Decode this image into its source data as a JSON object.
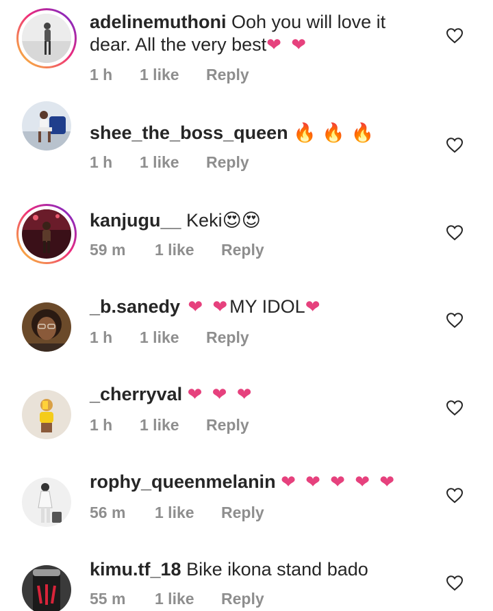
{
  "comments": [
    {
      "username": "adelinemuthoni",
      "text_line1": " Ooh you will love it",
      "text_line2": "dear. All the very best",
      "emoji": "❤ ❤",
      "time": "1 h",
      "likes": "1 like",
      "reply": "Reply",
      "story_ring": true,
      "icon": "heart-outline-icon"
    },
    {
      "username": "shee_the_boss_queen",
      "text": "",
      "emoji": "🔥 🔥 🔥",
      "time": "1 h",
      "likes": "1 like",
      "reply": "Reply",
      "story_ring": false,
      "icon": "heart-outline-icon"
    },
    {
      "username": "kanjugu__",
      "text": " Keki",
      "emoji": "😍😍",
      "time": "59 m",
      "likes": "1 like",
      "reply": "Reply",
      "story_ring": true,
      "icon": "heart-outline-icon"
    },
    {
      "username": "_b.sanedy",
      "emoji_before": " ❤ ❤",
      "text": "MY IDOL",
      "emoji": "❤",
      "time": "1 h",
      "likes": "1 like",
      "reply": "Reply",
      "story_ring": false,
      "icon": "heart-outline-icon"
    },
    {
      "username": "_cherryval",
      "text": "",
      "emoji": "❤ ❤ ❤",
      "time": "1 h",
      "likes": "1 like",
      "reply": "Reply",
      "story_ring": false,
      "icon": "heart-outline-icon"
    },
    {
      "username": "rophy_queenmelanin",
      "text": "",
      "emoji": "❤ ❤ ❤ ❤ ❤",
      "time": "56 m",
      "likes": "1 like",
      "reply": "Reply",
      "story_ring": false,
      "icon": "heart-outline-icon"
    },
    {
      "username": "kimu.tf_18",
      "text": " Bike ikona stand bado",
      "emoji": "",
      "time": "55 m",
      "likes": "1 like",
      "reply": "Reply",
      "story_ring": false,
      "icon": "heart-outline-icon"
    }
  ],
  "colors": {
    "text": "#262626",
    "meta": "#8e8e8e",
    "heart_emoji": "#e6417d",
    "story_ring_start": "#f9ce34",
    "story_ring_end": "#6228d7"
  }
}
